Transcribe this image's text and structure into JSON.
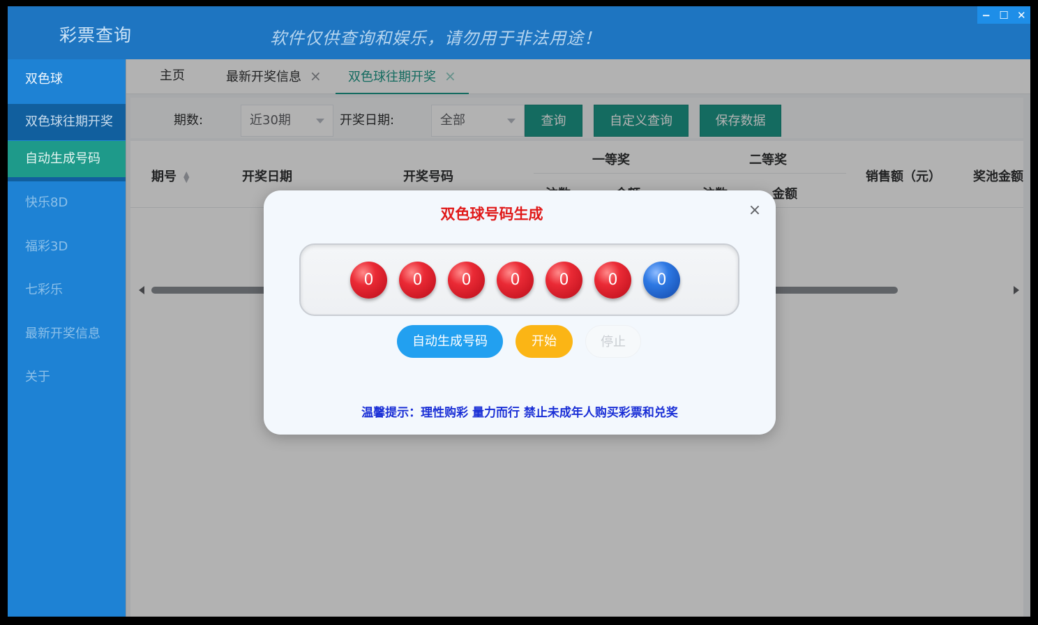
{
  "app": {
    "title": "彩票查询",
    "slogan": "软件仅供查询和娱乐，请勿用于非法用途！",
    "window_controls": {
      "minimize": "−",
      "maximize": "☐",
      "close": "✕"
    }
  },
  "sidebar": {
    "items": [
      {
        "label": "双色球"
      },
      {
        "label": "双色球往期开奖"
      },
      {
        "label": "自动生成号码"
      },
      {
        "label": "快乐8D"
      },
      {
        "label": "福彩3D"
      },
      {
        "label": "七彩乐"
      },
      {
        "label": "最新开奖信息"
      },
      {
        "label": "关于"
      }
    ]
  },
  "tabs": [
    {
      "label": "主页"
    },
    {
      "label": "最新开奖信息",
      "close": "×"
    },
    {
      "label": "双色球往期开奖",
      "close": "×"
    }
  ],
  "toolbar": {
    "period_label": "期数:",
    "period_value": "近30期",
    "date_label": "开奖日期:",
    "date_value": "全部",
    "query_button": "查询",
    "custom_query_button": "自定义查询",
    "save_button": "保存数据"
  },
  "table": {
    "headers": {
      "issue": "期号",
      "draw_date": "开奖日期",
      "numbers": "开奖号码",
      "first_prize": "一等奖",
      "second_prize": "二等奖",
      "first_count": "注数",
      "first_amount": "金额",
      "second_count": "注数",
      "second_amount": "金额",
      "sales": "销售额（元）",
      "pool": "奖池金额"
    }
  },
  "dialog": {
    "title": "双色球号码生成",
    "close": "×",
    "balls": [
      {
        "value": "0",
        "color": "red"
      },
      {
        "value": "0",
        "color": "red"
      },
      {
        "value": "0",
        "color": "red"
      },
      {
        "value": "0",
        "color": "red"
      },
      {
        "value": "0",
        "color": "red"
      },
      {
        "value": "0",
        "color": "red"
      },
      {
        "value": "0",
        "color": "blue"
      }
    ],
    "auto_button": "自动生成号码",
    "start_button": "开始",
    "stop_button": "停止",
    "tip": "温馨提示：理性购彩 量力而行 禁止未成年人购买彩票和兑奖"
  }
}
